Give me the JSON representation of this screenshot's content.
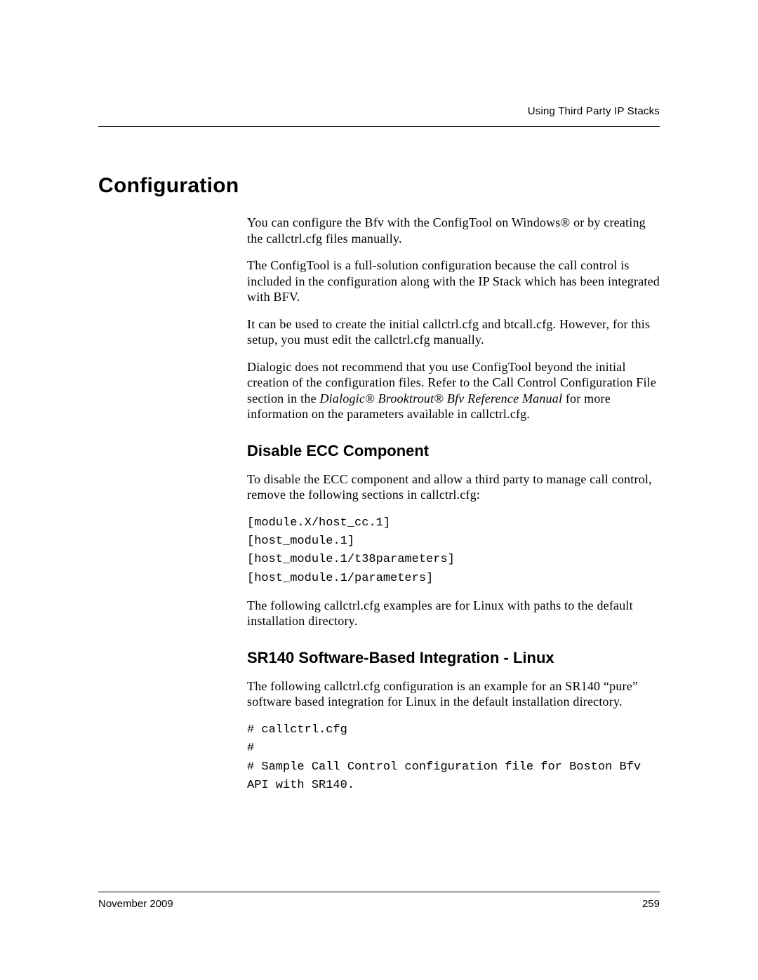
{
  "header": {
    "running_head": "Using Third Party IP Stacks"
  },
  "section": {
    "title": "Configuration",
    "paragraphs": {
      "p1": "You can configure the Bfv with the ConfigTool on Windows® or by creating the callctrl.cfg files manually.",
      "p2": "The ConfigTool is a full-solution configuration because the call control is included in the configuration along with the IP Stack which has been integrated with BFV.",
      "p3": "It can be used to create the initial callctrl.cfg and btcall.cfg. However, for this setup, you must edit the callctrl.cfg manually.",
      "p4_pre": "Dialogic does not recommend that you use ConfigTool beyond the initial creation of the configuration files. Refer to the Call Control Configuration File section in the ",
      "p4_em": "Dialogic® Brooktrout® Bfv Reference Manual",
      "p4_post": " for more information on the parameters available in callctrl.cfg."
    },
    "sub1": {
      "title": "Disable ECC Component",
      "p1": "To disable the ECC component and allow a third party to manage call control, remove the following sections in callctrl.cfg:",
      "code": "[module.X/host_cc.1]\n[host_module.1]\n[host_module.1/t38parameters]\n[host_module.1/parameters]",
      "p2": "The following callctrl.cfg examples are for Linux with paths to the default installation directory."
    },
    "sub2": {
      "title": "SR140 Software-Based Integration - Linux",
      "p1": "The following callctrl.cfg configuration is an example for an SR140 “pure” software based integration for Linux in the default installation directory.",
      "code": "# callctrl.cfg\n#\n# Sample Call Control configuration file for Boston Bfv API with SR140."
    }
  },
  "footer": {
    "date": "November 2009",
    "page": "259"
  }
}
